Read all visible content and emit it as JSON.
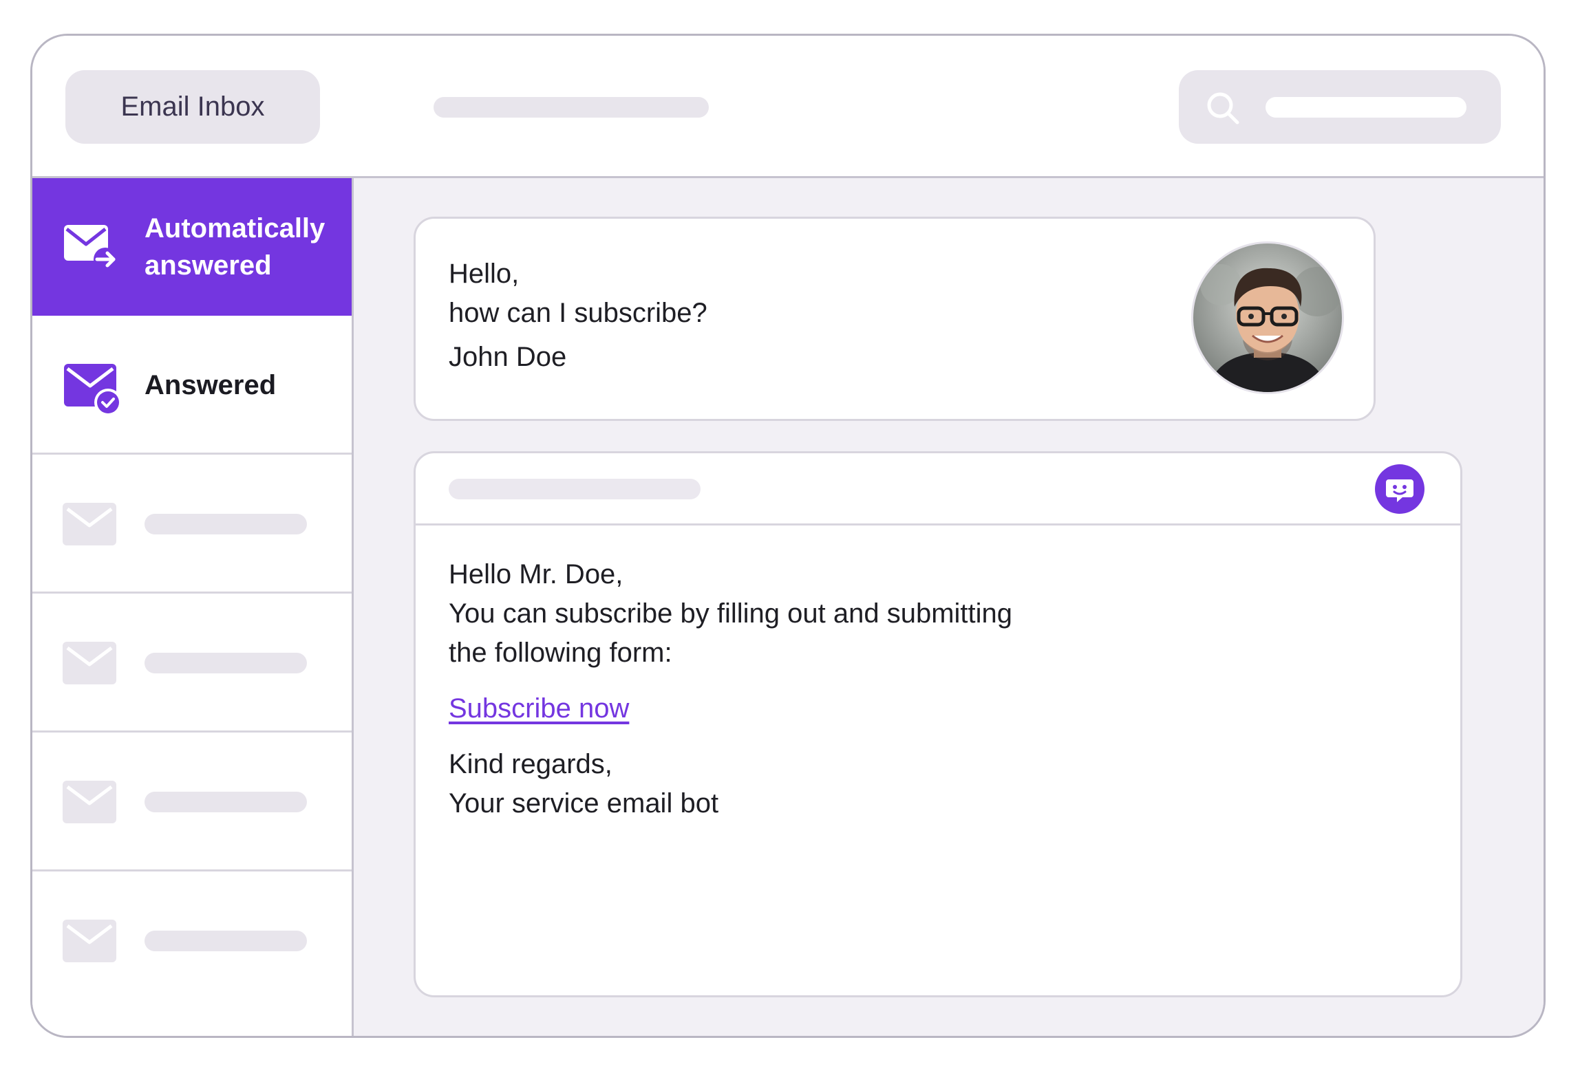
{
  "header": {
    "title": "Email Inbox",
    "search_icon": "search-icon"
  },
  "sidebar": {
    "items": [
      {
        "label_line1": "Automatically",
        "label_line2": "answered",
        "icon": "mail-forward-icon",
        "active": true
      },
      {
        "label": "Answered",
        "icon": "mail-check-icon",
        "active": false
      },
      {
        "icon": "mail-icon"
      },
      {
        "icon": "mail-icon"
      },
      {
        "icon": "mail-icon"
      },
      {
        "icon": "mail-icon"
      }
    ]
  },
  "incoming_message": {
    "greeting": "Hello,",
    "question": "how can I subscribe?",
    "sender": "John Doe",
    "avatar": "avatar-photo"
  },
  "reply_message": {
    "bot_icon": "chatbot-icon",
    "greeting": "Hello Mr. Doe,",
    "body_line1": "You can subscribe by filling out and submitting",
    "body_line2": "the following form:",
    "link_text": "Subscribe now",
    "closing": "Kind regards,",
    "signature": "Your service email bot"
  },
  "colors": {
    "accent": "#7436e0",
    "placeholder": "#e8e5ec",
    "content_bg": "#f2f0f5",
    "border": "#b9b6c3"
  }
}
